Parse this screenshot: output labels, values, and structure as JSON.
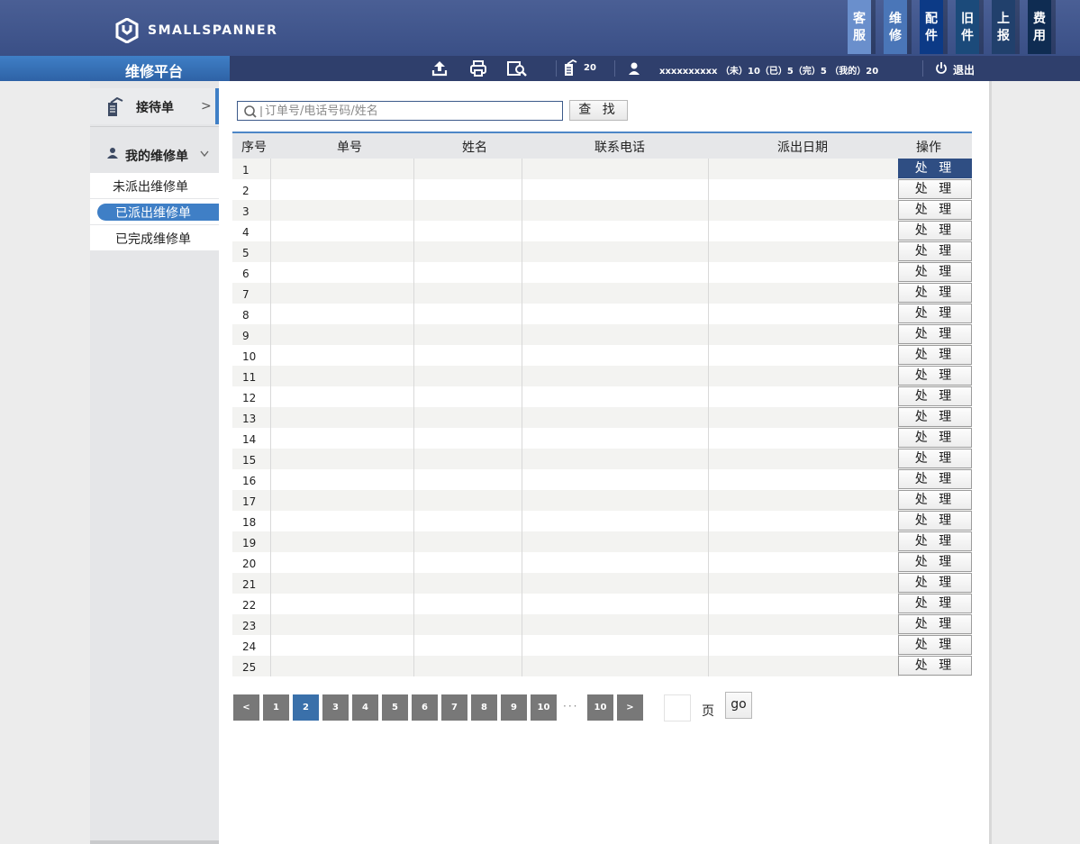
{
  "header": {
    "logo_text": "SMALLSPANNER",
    "nav_tabs": [
      {
        "c1": "客",
        "c2": "服",
        "color": "#6a8fcc"
      },
      {
        "c1": "维",
        "c2": "修",
        "color": "#4a76b8"
      },
      {
        "c1": "配",
        "c2": "件",
        "color": "#0c3a86"
      },
      {
        "c1": "旧",
        "c2": "件",
        "color": "#1b4a7a"
      },
      {
        "c1": "上",
        "c2": "报",
        "color": "#21406c"
      },
      {
        "c1": "费",
        "c2": "用",
        "color": "#0f2c52"
      }
    ]
  },
  "subbar": {
    "brand": "维修平台",
    "order_count": "20",
    "user_info": "xxxxxxxxxx （未）10（已）5（完）5 （我的）20",
    "logout": "退出"
  },
  "sidebar": {
    "reception": "接待单",
    "reception_arrow": ">",
    "my_orders": "我的维修单",
    "sub_items": [
      "未派出维修单",
      "已派出维修单",
      "已完成维修单"
    ],
    "active_index": 1
  },
  "search": {
    "placeholder": "订单号/电话号码/姓名",
    "button": "查 找"
  },
  "table": {
    "headers": [
      "序号",
      "单号",
      "姓名",
      "联系电话",
      "派出日期",
      "操作"
    ],
    "action_label": "处 理",
    "rows": [
      "1",
      "2",
      "3",
      "4",
      "5",
      "6",
      "7",
      "8",
      "9",
      "10",
      "11",
      "12",
      "13",
      "14",
      "15",
      "16",
      "17",
      "18",
      "19",
      "20",
      "21",
      "22",
      "23",
      "24",
      "25"
    ],
    "active_row": 0
  },
  "pagination": {
    "prev": "<",
    "pages": [
      "1",
      "2",
      "3",
      "4",
      "5",
      "6",
      "7",
      "8",
      "9",
      "10"
    ],
    "current": "2",
    "ellipsis": "···",
    "last": "10",
    "next": ">",
    "page_label": "页",
    "go": "go"
  }
}
